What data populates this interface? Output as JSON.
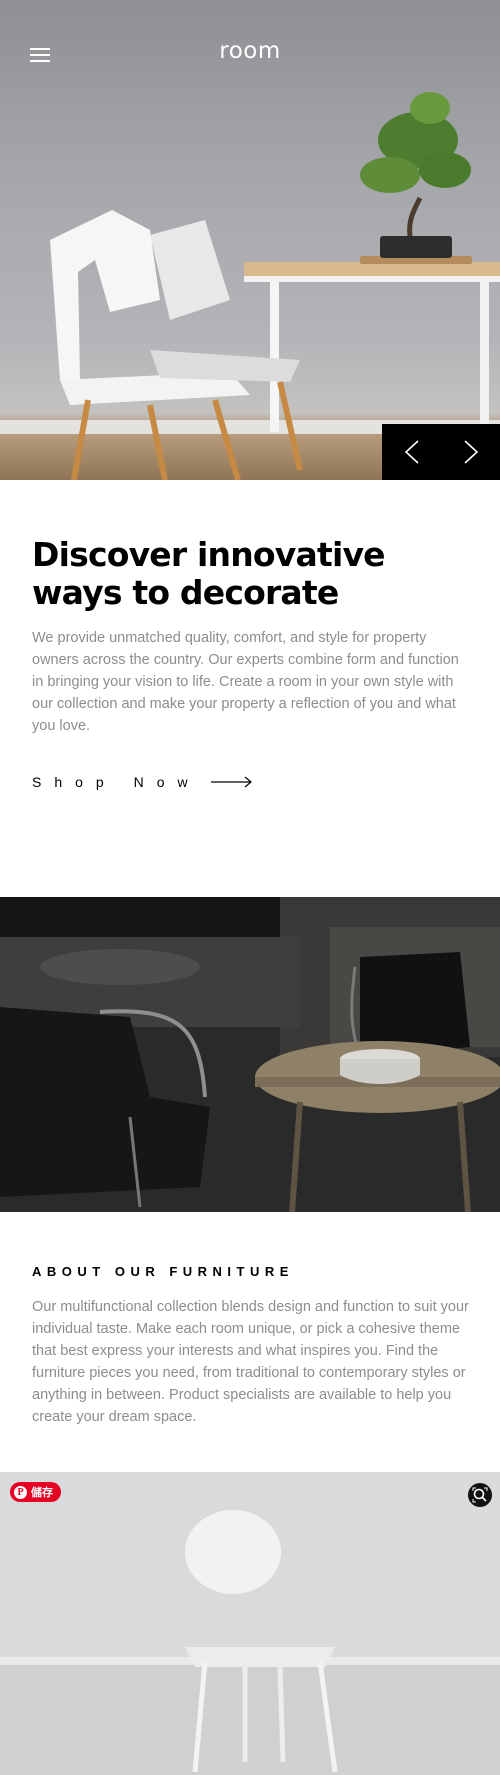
{
  "header": {
    "brand": "room",
    "menu_icon": "hamburger-menu-icon"
  },
  "hero": {
    "prev_icon": "chevron-left-icon",
    "next_icon": "chevron-right-icon"
  },
  "intro": {
    "title": "Discover innovative ways to decorate",
    "text": "We provide unmatched quality, comfort, and style for property owners across the country. Our experts combine form and function in bringing your vision to life. Create a room in your own style with our collection and make your property a reflection of you and what you love.",
    "cta_label": "Shop Now",
    "cta_icon": "arrow-right-icon"
  },
  "about": {
    "heading": "ABOUT OUR FURNITURE",
    "text": "Our multifunctional collection blends design and function to suit your individual taste. Make each room unique, or pick a cohesive theme that best express your interests and what inspires you. Find the furniture pieces you need, from traditional to contemporary styles or anything in between. Product specialists are available to help you create your dream space."
  },
  "overlay": {
    "save_label": "儲存",
    "save_icon": "pinterest-icon",
    "lens_icon": "visual-search-icon"
  },
  "colors": {
    "accent_black": "#000000",
    "body_text": "#8d8d8d",
    "pinterest_red": "#e60023"
  }
}
